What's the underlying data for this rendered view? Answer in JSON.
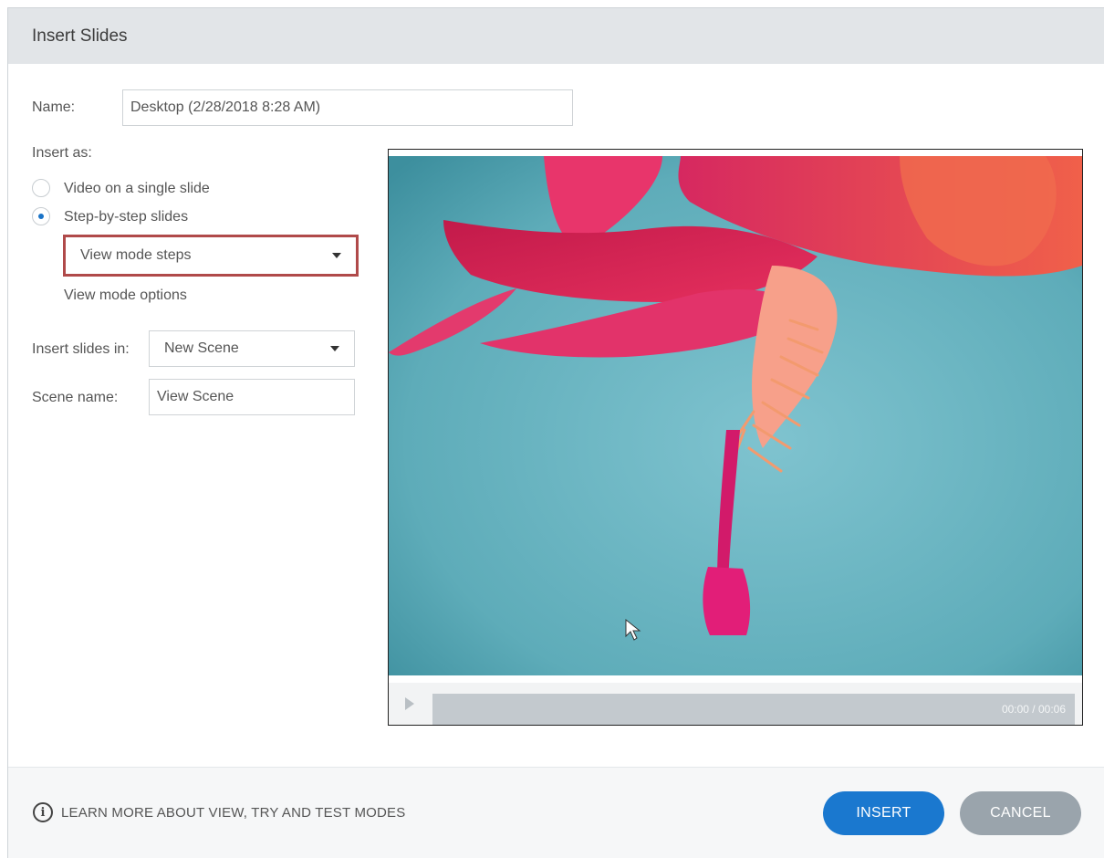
{
  "dialog": {
    "title": "Insert Slides"
  },
  "form": {
    "name_label": "Name:",
    "name_value": "Desktop (2/28/2018 8:28 AM)",
    "insert_as_label": "Insert as:",
    "options": [
      {
        "label": "Video on a single slide",
        "selected": false
      },
      {
        "label": "Step-by-step slides",
        "selected": true
      }
    ],
    "mode_select_value": "View mode steps",
    "mode_options_link": "View mode options",
    "insert_in_label": "Insert slides in:",
    "insert_in_value": "New Scene",
    "scene_name_label": "Scene name:",
    "scene_name_value": "View Scene"
  },
  "preview": {
    "time": "00:00 / 00:06",
    "progress": 0
  },
  "footer": {
    "learn_more": "LEARN MORE ABOUT VIEW, TRY AND TEST MODES",
    "insert_label": "INSERT",
    "cancel_label": "CANCEL"
  },
  "colors": {
    "accent": "#1a78cf",
    "highlight_border": "#b04a4a",
    "cancel": "#9aa4ac",
    "photo_background": "#5fb0bd"
  },
  "icons": [
    "info-icon",
    "play-icon",
    "chevron-down-icon",
    "mouse-cursor-icon"
  ]
}
